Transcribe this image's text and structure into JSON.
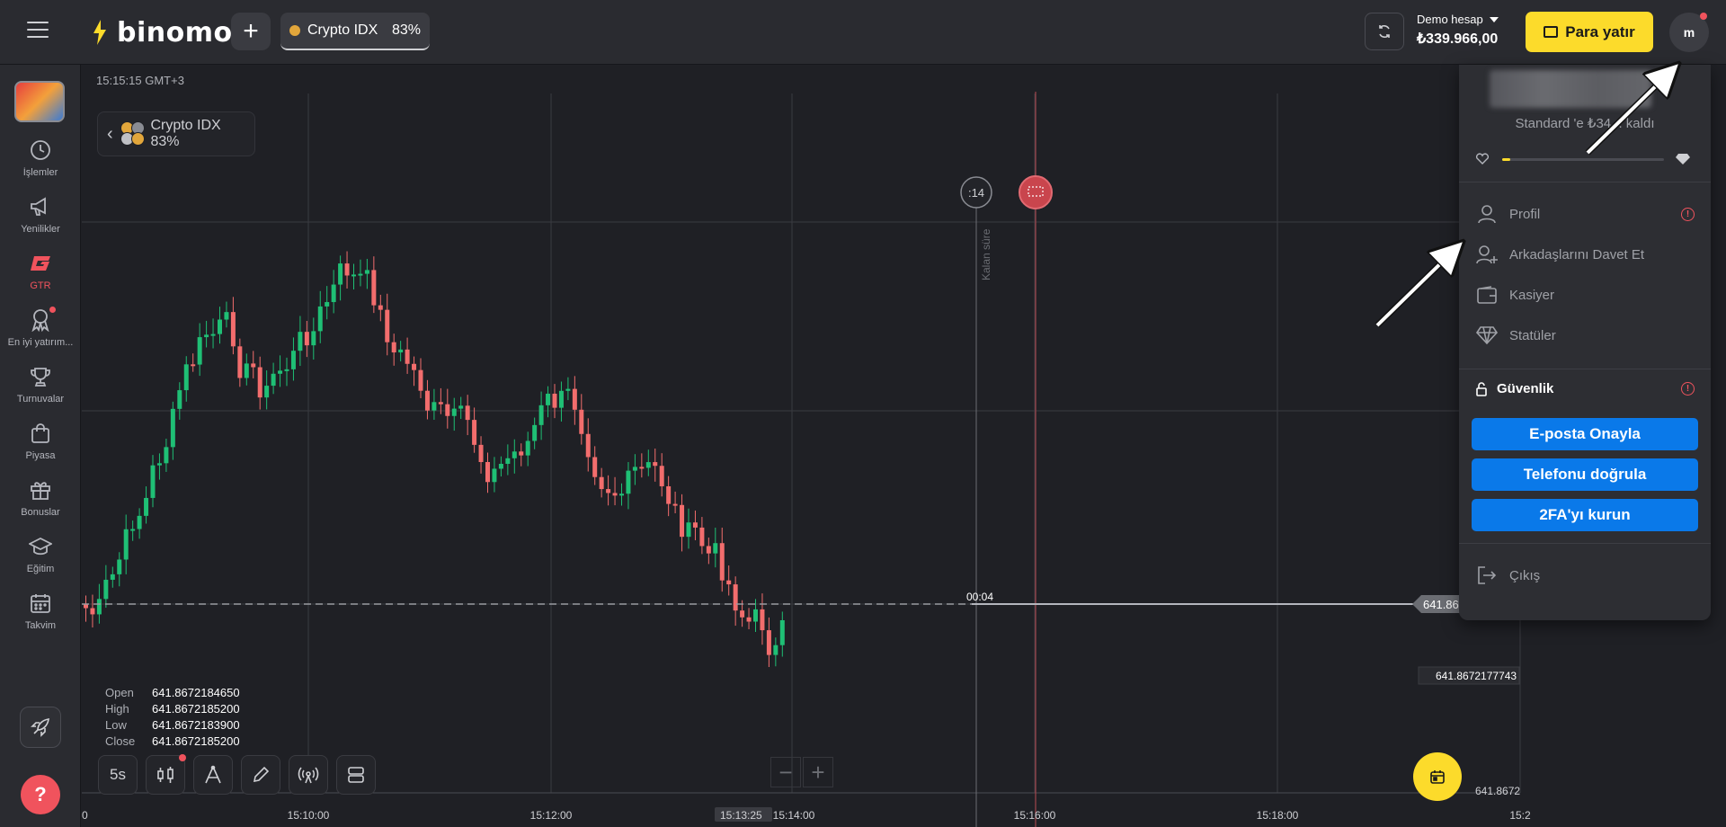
{
  "header": {
    "logo_text": "binomo",
    "asset_tab": {
      "name": "Crypto IDX",
      "payout": "83%"
    },
    "account": {
      "label": "Demo hesap",
      "balance": "₺339.966,00"
    },
    "deposit_label": "Para yatır",
    "avatar_initial": "m"
  },
  "sidebar": {
    "items": [
      {
        "label": "İşlemler",
        "icon": "clock-icon"
      },
      {
        "label": "Yenilikler",
        "icon": "megaphone-icon"
      },
      {
        "label": "GTR",
        "icon": "gtr-icon"
      },
      {
        "label": "En iyi yatırım...",
        "icon": "award-icon"
      },
      {
        "label": "Turnuvalar",
        "icon": "trophy-icon"
      },
      {
        "label": "Piyasa",
        "icon": "shopping-bag-icon"
      },
      {
        "label": "Bonuslar",
        "icon": "gift-icon"
      },
      {
        "label": "Eğitim",
        "icon": "graduation-cap-icon"
      },
      {
        "label": "Takvim",
        "icon": "calendar-icon"
      }
    ],
    "active_color": "#f0535d"
  },
  "chart": {
    "server_time": "15:15:15 GMT+3",
    "asset_label": "Crypto IDX 83%",
    "expiry_badge": ":14",
    "vertical_label": "Kalan süre",
    "countdown": "00:04",
    "current_price_tag": "641.86",
    "price_tag_2": "641.8672177743",
    "price_tag_3": "641.8672",
    "x_ticks": [
      "0",
      "15:10:00",
      "15:12:00",
      "15:13:25",
      "15:14:00",
      "15:16:00",
      "15:18:00",
      "15:2"
    ],
    "ohlc": {
      "open_label": "Open",
      "open": "641.8672184650",
      "high_label": "High",
      "high": "641.8672185200",
      "low_label": "Low",
      "low": "641.8672183900",
      "close_label": "Close",
      "close": "641.8672185200"
    },
    "timeframe": "5s",
    "colors": {
      "up": "#1fbf75",
      "down": "#f26d6d",
      "grid": "#3a3b41"
    }
  },
  "dropdown": {
    "status_text": "Standard 'e ₺34... kaldı",
    "status_progress": 0.05,
    "menu": [
      {
        "label": "Profil",
        "icon": "user-icon",
        "warning": true
      },
      {
        "label": "Arkadaşlarını Davet Et",
        "icon": "user-plus-icon",
        "warning": false
      },
      {
        "label": "Kasiyer",
        "icon": "wallet-icon",
        "warning": false
      },
      {
        "label": "Statüler",
        "icon": "diamond-icon",
        "warning": false
      }
    ],
    "security": {
      "title": "Güvenlik",
      "buttons": [
        "E-posta Onayla",
        "Telefonu doğrula",
        "2FA'yı kurun"
      ]
    },
    "logout_label": "Çıkış"
  }
}
